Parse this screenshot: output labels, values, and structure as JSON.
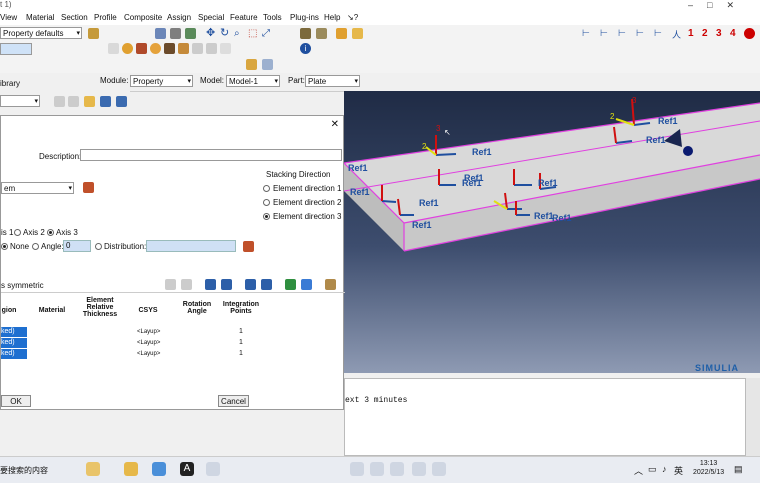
{
  "window": {
    "title": "t 1)"
  },
  "menu": [
    "View",
    "Material",
    "Section",
    "Profile",
    "Composite",
    "Assign",
    "Special",
    "Feature",
    "Tools",
    "Plug-ins",
    "Help",
    "↘?"
  ],
  "toolbar": {
    "property_defaults": "Property defaults",
    "view_numbers": [
      "1",
      "2",
      "3",
      "4"
    ]
  },
  "context": {
    "library_label": "ibrary",
    "module_label": "Module:",
    "module_value": "Property",
    "model_label": "Model:",
    "model_value": "Model-1",
    "part_label": "Part:",
    "part_value": "Plate"
  },
  "dialog": {
    "description_label": "Description:",
    "csys_value": "em",
    "stacking_title": "Stacking Direction",
    "stacking_options": [
      "Element direction 1",
      "Element direction 2",
      "Element direction 3"
    ],
    "stacking_selected": 2,
    "axis_options": [
      "is 1",
      "Axis 2",
      "Axis 3"
    ],
    "axis_selected": 2,
    "rotation_none": "None",
    "rotation_angle_label": "Angle:",
    "rotation_angle_value": "0",
    "distribution_label": "Distribution:",
    "symmetric_label": "s symmetric",
    "table_headers": [
      "gion",
      "Material",
      "Element Relative Thickness",
      "CSYS",
      "Rotation Angle",
      "Integration Points"
    ],
    "rows": [
      {
        "region": "ked)",
        "csys": "<Layup>",
        "ip": "1"
      },
      {
        "region": "ked)",
        "csys": "<Layup>",
        "ip": "1"
      },
      {
        "region": "ked)",
        "csys": "<Layup>",
        "ip": "1"
      }
    ],
    "ok_label": "OK",
    "cancel_label": "Cancel"
  },
  "viewport": {
    "ref_label": "Ref1",
    "axis_labels": [
      "1",
      "2",
      "3"
    ],
    "brand": "SIMULIA"
  },
  "messages": {
    "line": "ext 3 minutes"
  },
  "taskbar": {
    "search_text": "要搜索的内容",
    "lang": "英",
    "time": "13:13",
    "date": "2022/5/13"
  },
  "colors": {
    "viewport_top": "#1f2b45",
    "viewport_bottom": "#8e9ab3",
    "highlight_edge": "#e040e0",
    "selected_row": "#1e6fd0"
  }
}
